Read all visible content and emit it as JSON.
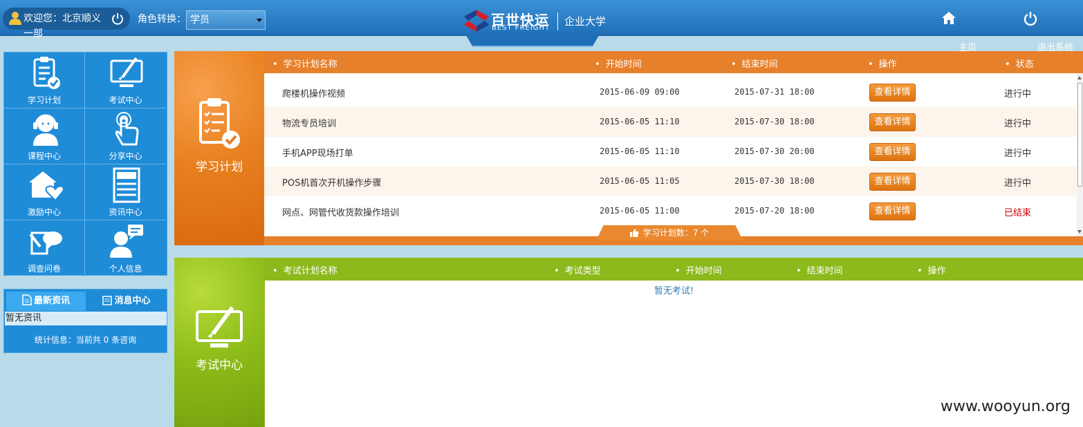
{
  "header": {
    "welcome_line1": "欢迎您：北京顺义",
    "welcome_line2": "一部",
    "role_label": "角色转换：",
    "role_value": "学员",
    "logo_cn": "百世快运",
    "logo_en": "BEST FREIGHT",
    "logo_univ": "企业大学",
    "home_label": "主页",
    "exit_label": "退出系统"
  },
  "nav": [
    {
      "label": "学习计划",
      "icon": "clipboard-check-icon"
    },
    {
      "label": "考试中心",
      "icon": "monitor-pen-icon"
    },
    {
      "label": "课程中心",
      "icon": "headset-person-icon"
    },
    {
      "label": "分享中心",
      "icon": "hand-pointer-icon"
    },
    {
      "label": "激励中心",
      "icon": "house-heart-icon"
    },
    {
      "label": "资讯中心",
      "icon": "newspaper-icon"
    },
    {
      "label": "调查问卷",
      "icon": "survey-question-icon"
    },
    {
      "label": "个人信息",
      "icon": "person-chat-icon"
    }
  ],
  "news": {
    "tab_latest": "最新资讯",
    "tab_messages": "消息中心",
    "empty": "暂无资讯",
    "stat": "统计信息：当前共 0 条咨询"
  },
  "study": {
    "title": "学习计划",
    "headers": [
      "学习计划名称",
      "开始时间",
      "结束时间",
      "操作",
      "状态"
    ],
    "rows": [
      {
        "name": "爬楼机操作视频",
        "start": "2015-06-09 09:00",
        "end": "2015-07-31 18:00",
        "action": "查看详情",
        "status": "进行中"
      },
      {
        "name": "物流专员培训",
        "start": "2015-06-05 11:10",
        "end": "2015-07-30 18:00",
        "action": "查看详情",
        "status": "进行中"
      },
      {
        "name": "手机APP现场打单",
        "start": "2015-06-05 11:10",
        "end": "2015-07-30 20:00",
        "action": "查看详情",
        "status": "进行中"
      },
      {
        "name": "POS机首次开机操作步骤",
        "start": "2015-06-05 11:05",
        "end": "2015-07-30 18:00",
        "action": "查看详情",
        "status": "进行中"
      },
      {
        "name": "网点、网管代收货款操作培训",
        "start": "2015-06-05 11:00",
        "end": "2015-07-20 18:00",
        "action": "查看详情",
        "status": "已结束"
      }
    ],
    "count": "学习计划数：7 个",
    "colors": {
      "ongoing": "#333333",
      "ended": "#d40000"
    }
  },
  "exam": {
    "title": "考试中心",
    "headers": [
      "考试计划名称",
      "考试类型",
      "开始时间",
      "结束时间",
      "操作"
    ],
    "empty": "暂无考试!"
  },
  "watermark": "www.wooyun.org"
}
